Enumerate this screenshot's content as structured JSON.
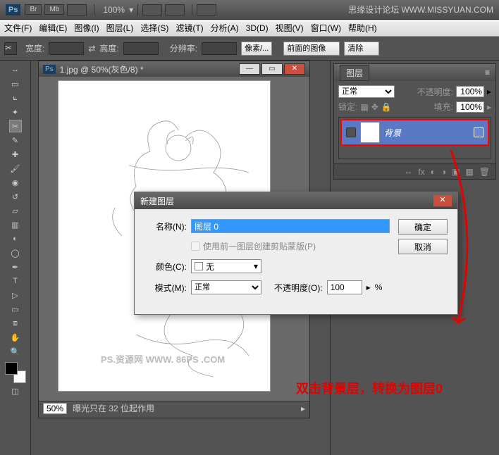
{
  "app": {
    "ps": "Ps",
    "br": "Br",
    "mb": "Mb",
    "zoom": "100%",
    "forum": "思缘设计论坛",
    "url": "WWW.MISSYUAN.COM"
  },
  "menu": {
    "file": "文件(F)",
    "edit": "编辑(E)",
    "image": "图像(I)",
    "layer": "图层(L)",
    "select": "选择(S)",
    "filter": "滤镜(T)",
    "analysis": "分析(A)",
    "threed": "3D(D)",
    "view": "视图(V)",
    "window": "窗口(W)",
    "help": "帮助(H)"
  },
  "opt": {
    "width": "宽度:",
    "height": "高度:",
    "res": "分辨率:",
    "px": "像素/...",
    "front": "前面的图像",
    "clear": "清除"
  },
  "doc": {
    "title": "1.jpg @ 50%(灰色/8) *",
    "zoom": "50%",
    "status": "曝光只在 32 位起作用",
    "wm": "PS.资源网   WWW. 86PS .COM"
  },
  "panel": {
    "tab": "图层",
    "blend": "正常",
    "opLabel": "不透明度:",
    "op": "100%",
    "lockLabel": "锁定:",
    "fillLabel": "填充:",
    "fill": "100%",
    "layerName": "背景"
  },
  "dlg": {
    "title": "新建图层",
    "nameLabel": "名称(N):",
    "nameVal": "图层 0",
    "cb": "使用前一图层创建剪贴蒙版(P)",
    "colorLabel": "颜色(C):",
    "colorVal": "无",
    "modeLabel": "模式(M):",
    "modeVal": "正常",
    "opLabel": "不透明度(O):",
    "opVal": "100",
    "pct": "%",
    "ok": "确定",
    "cancel": "取消"
  },
  "anno": "双击背景层，转换为图层0"
}
